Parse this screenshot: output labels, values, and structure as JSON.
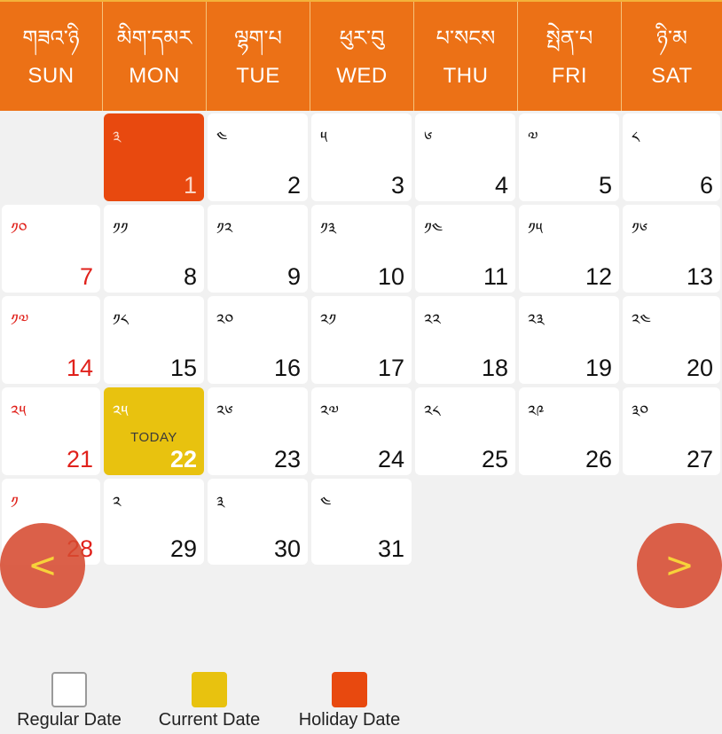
{
  "header": {
    "days": [
      {
        "tib": "གཟའ་ཉི",
        "en": "SUN"
      },
      {
        "tib": "མིག་དམར",
        "en": "MON"
      },
      {
        "tib": "ལྷག་པ",
        "en": "TUE"
      },
      {
        "tib": "ཕུར་བུ",
        "en": "WED"
      },
      {
        "tib": "པ་སངས",
        "en": "THU"
      },
      {
        "tib": "སྤེན་པ",
        "en": "FRI"
      },
      {
        "tib": "ཉི་མ",
        "en": "SAT"
      }
    ]
  },
  "calendar": {
    "rows": [
      [
        {
          "empty": true
        },
        {
          "tib": "༣",
          "num": "1",
          "type": "holiday"
        },
        {
          "tib": "༤",
          "num": "2"
        },
        {
          "tib": "༥",
          "num": "3"
        },
        {
          "tib": "༦",
          "num": "4"
        },
        {
          "tib": "༧",
          "num": "5"
        },
        {
          "tib": "༨",
          "num": "6"
        }
      ],
      [
        {
          "tib": "༡༠",
          "num": "7",
          "type": "sunday"
        },
        {
          "tib": "༡༡",
          "num": "8"
        },
        {
          "tib": "༡༢",
          "num": "9"
        },
        {
          "tib": "༡༣",
          "num": "10"
        },
        {
          "tib": "༡༤",
          "num": "11"
        },
        {
          "tib": "༡༥",
          "num": "12"
        },
        {
          "tib": "༡༦",
          "num": "13"
        }
      ],
      [
        {
          "tib": "༡༧",
          "num": "14",
          "type": "sunday"
        },
        {
          "tib": "༡༨",
          "num": "15"
        },
        {
          "tib": "༢༠",
          "num": "16"
        },
        {
          "tib": "༢༡",
          "num": "17"
        },
        {
          "tib": "༢༢",
          "num": "18"
        },
        {
          "tib": "༢༣",
          "num": "19"
        },
        {
          "tib": "༢༤",
          "num": "20"
        }
      ],
      [
        {
          "tib": "༢༥",
          "num": "21",
          "type": "sunday"
        },
        {
          "tib": "༢༥",
          "num": "22",
          "type": "today",
          "label": "TODAY"
        },
        {
          "tib": "༢༦",
          "num": "23"
        },
        {
          "tib": "༢༧",
          "num": "24"
        },
        {
          "tib": "༢༨",
          "num": "25"
        },
        {
          "tib": "༢༩",
          "num": "26"
        },
        {
          "tib": "༣༠",
          "num": "27"
        }
      ],
      [
        {
          "tib": "༡",
          "num": "28",
          "type": "sunday"
        },
        {
          "tib": "༢",
          "num": "29"
        },
        {
          "tib": "༣",
          "num": "30"
        },
        {
          "tib": "༤",
          "num": "31"
        }
      ]
    ]
  },
  "nav": {
    "prev": "<",
    "next": ">"
  },
  "legend": {
    "items": [
      {
        "label": "Regular Date",
        "color": "#ffffff"
      },
      {
        "label": "Current Date",
        "color": "#e8c20f"
      },
      {
        "label": "Holiday Date",
        "color": "#e8490f"
      }
    ]
  }
}
